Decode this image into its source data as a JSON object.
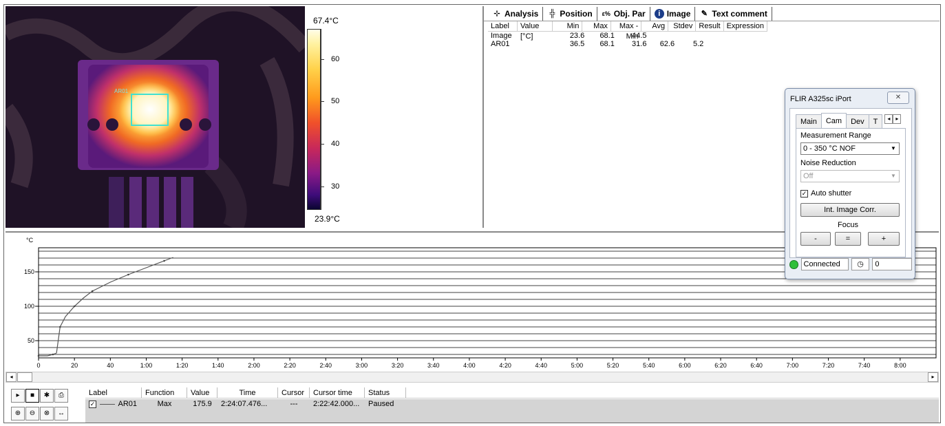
{
  "thermal": {
    "roi_label": "AR01",
    "scale_max": "67.4°C",
    "scale_min": "23.9°C",
    "scale_ticks": [
      "60",
      "50",
      "40",
      "30"
    ],
    "palette": [
      "#fffde8",
      "#ffd24a",
      "#ff9a1c",
      "#f0502a",
      "#c8285a",
      "#8a1a86",
      "#3e0c7a",
      "#0a0530"
    ]
  },
  "analysis": {
    "tabs": [
      {
        "label": "Analysis",
        "icon": "analysis-icon"
      },
      {
        "label": "Position",
        "icon": "position-icon"
      },
      {
        "label": "Obj. Par",
        "icon": "object-parameters-icon"
      },
      {
        "label": "Image",
        "icon": "info-icon"
      },
      {
        "label": "Text comment",
        "icon": "text-comment-icon"
      }
    ],
    "columns": [
      "Label",
      "Value [°C]",
      "Min",
      "Max",
      "Max - Min",
      "Avg",
      "Stdev",
      "Result",
      "Expression"
    ],
    "rows": [
      {
        "label": "Image",
        "value": "",
        "min": "23.6",
        "max": "68.1",
        "maxmin": "44.5",
        "avg": "",
        "stdev": "",
        "result": "",
        "expression": ""
      },
      {
        "label": "AR01",
        "value": "",
        "min": "36.5",
        "max": "68.1",
        "maxmin": "31.6",
        "avg": "62.6",
        "stdev": "5.2",
        "result": "",
        "expression": ""
      }
    ]
  },
  "dialog": {
    "title": "FLIR A325sc iPort",
    "tabs": [
      "Main",
      "Cam",
      "Dev",
      "T"
    ],
    "measurement_range_label": "Measurement Range",
    "measurement_range_value": "0 - 350 °C NOF",
    "noise_reduction_label": "Noise Reduction",
    "noise_reduction_value": "Off",
    "auto_shutter_label": "Auto shutter",
    "auto_shutter_checked": true,
    "int_image_corr_label": "Int. Image Corr.",
    "focus_label": "Focus",
    "focus_minus": "-",
    "focus_equal": "=",
    "focus_plus": "+",
    "status": "Connected",
    "counter": "0"
  },
  "chart_data": {
    "type": "line",
    "ylabel": "°C",
    "ylim": [
      25,
      185
    ],
    "yticks": [
      50,
      100,
      150
    ],
    "xlim": [
      0,
      500
    ],
    "xtick_labels": [
      "0",
      "20",
      "40",
      "1:00",
      "1:20",
      "1:40",
      "2:00",
      "2:20",
      "2:40",
      "3:00",
      "3:20",
      "3:40",
      "4:00",
      "4:20",
      "4:40",
      "5:00",
      "5:20",
      "5:40",
      "6:00",
      "6:20",
      "6:40",
      "7:00",
      "7:20",
      "7:40",
      "8:00"
    ],
    "xtick_values": [
      0,
      20,
      40,
      60,
      80,
      100,
      120,
      140,
      160,
      180,
      200,
      220,
      240,
      260,
      280,
      300,
      320,
      340,
      360,
      380,
      400,
      420,
      440,
      460,
      480
    ],
    "grid": true,
    "series": [
      {
        "name": "AR01",
        "x": [
          0,
          5,
          8,
          10,
          12,
          15,
          20,
          25,
          30,
          40,
          50,
          60,
          70,
          75
        ],
        "y": [
          28,
          28,
          30,
          32,
          70,
          85,
          100,
          112,
          122,
          135,
          146,
          156,
          166,
          171
        ]
      }
    ]
  },
  "legend": {
    "columns": [
      "Label",
      "Function",
      "Value",
      "Time",
      "Cursor",
      "Cursor time",
      "Status"
    ],
    "row": {
      "label": "AR01",
      "function": "Max",
      "value": "175.9",
      "time": "2:24:07.476...",
      "cursor": "---",
      "cursor_time": "2:22:42.000...",
      "status": "Paused"
    }
  }
}
